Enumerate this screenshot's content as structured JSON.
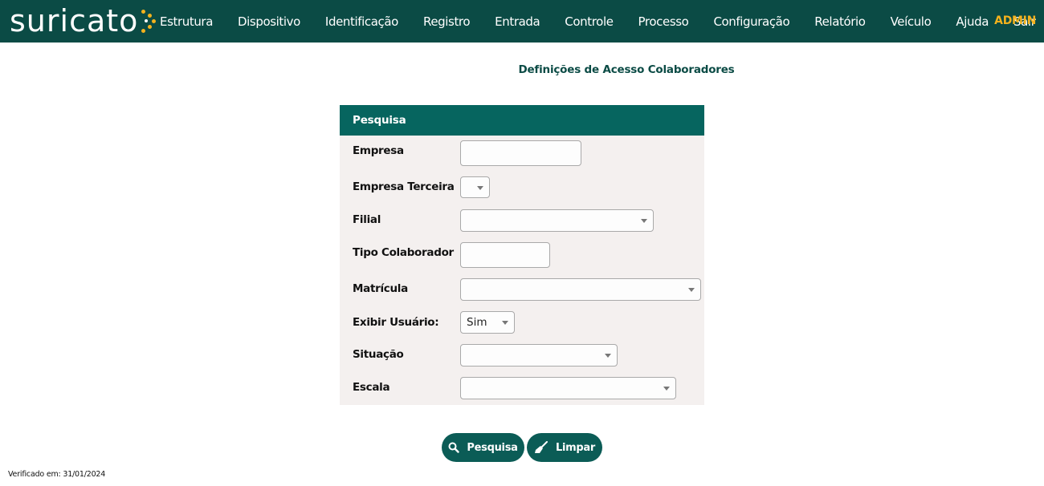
{
  "brand": {
    "logo_text": "suricato"
  },
  "nav": {
    "items": [
      "Estrutura",
      "Dispositivo",
      "Identificação",
      "Registro",
      "Entrada",
      "Controle",
      "Processo",
      "Configuração",
      "Relatório",
      "Veículo",
      "Ajuda",
      "Sair"
    ],
    "user": "ADMIN"
  },
  "page": {
    "title": "Definições de Acesso Colaboradores"
  },
  "panel": {
    "header": "Pesquisa",
    "fields": {
      "empresa": {
        "label": "Empresa",
        "value": ""
      },
      "empresa_terceira": {
        "label": "Empresa Terceira",
        "value": ""
      },
      "filial": {
        "label": "Filial",
        "value": ""
      },
      "tipo_colaborador": {
        "label": "Tipo Colaborador",
        "value": ""
      },
      "matricula": {
        "label": "Matrícula",
        "value": ""
      },
      "exibir_usuario": {
        "label": "Exibir Usuário:",
        "value": "Sim"
      },
      "situacao": {
        "label": "Situação",
        "value": ""
      },
      "escala": {
        "label": "Escala",
        "value": ""
      }
    }
  },
  "buttons": {
    "search": "Pesquisa",
    "clear": "Limpar"
  },
  "footer": {
    "verified": "Verificado em: 31/01/2024"
  },
  "icons": {
    "search_button": "search-icon",
    "clear_button": "broom-icon",
    "select": "chevron-down-icon"
  },
  "colors": {
    "topbar": "#0b4b45",
    "accent": "#f4b21d",
    "panel_header": "#06655f",
    "button": "#0b5c56",
    "panel_bg": "#f4f0ef"
  }
}
